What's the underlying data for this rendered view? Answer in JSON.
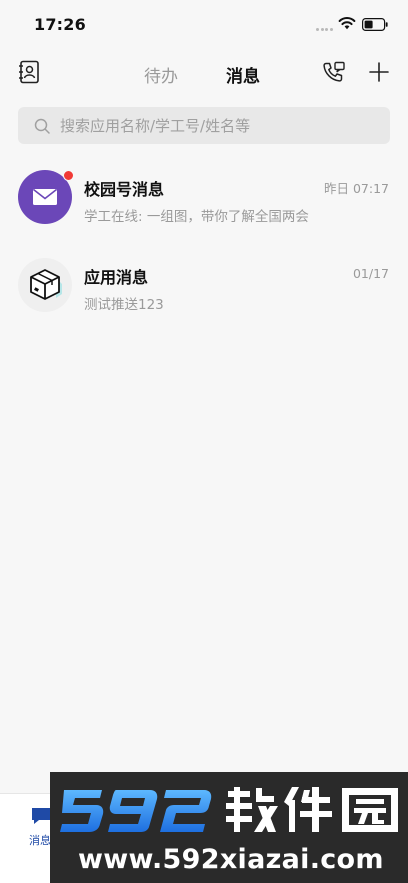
{
  "status_bar": {
    "time": "17:26"
  },
  "header": {
    "tabs": [
      {
        "label": "待办",
        "active": false
      },
      {
        "label": "消息",
        "active": true
      }
    ],
    "icons": [
      "contacts-icon",
      "call-icon",
      "plus-icon"
    ]
  },
  "search": {
    "placeholder": "搜索应用名称/学工号/姓名等"
  },
  "messages": [
    {
      "title": "校园号消息",
      "preview": "学工在线: 一组图，带你了解全国两会",
      "time": "昨日 07:17",
      "avatar_icon": "envelope-icon",
      "avatar_color": "#6b47b8",
      "unread": true
    },
    {
      "title": "应用消息",
      "preview": "测试推送123",
      "time": "01/17",
      "avatar_icon": "box-icon",
      "avatar_color": "#efefef",
      "unread": false
    }
  ],
  "bottom_nav": {
    "active_label": "消息",
    "accent_color": "#1f4aa6"
  },
  "watermark": {
    "brand": "592软件园",
    "url": "www.592xiazai.com"
  }
}
